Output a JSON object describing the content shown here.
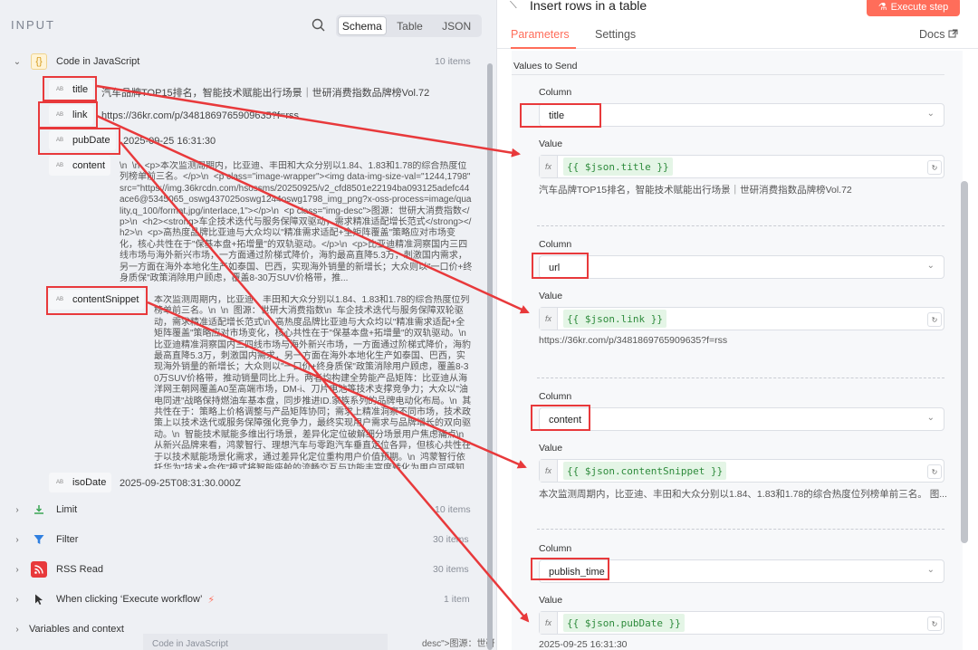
{
  "input_panel": {
    "title": "INPUT",
    "view_tabs": [
      "Schema",
      "Table",
      "JSON"
    ],
    "active_view": "Schema"
  },
  "tree": {
    "code_node": {
      "label": "Code in JavaScript",
      "count": "10 items",
      "icon": "braces-icon"
    },
    "fields": [
      {
        "name": "title",
        "value": "汽车品牌TOP15排名，智能技术赋能出行场景｜世研消费指数品牌榜Vol.72"
      },
      {
        "name": "link",
        "value": "https://36kr.com/p/3481869765909635?f=rss"
      },
      {
        "name": "pubDate",
        "value": "2025-09-25 16:31:30"
      },
      {
        "name": "content",
        "value": "\\n  \\n  <p>本次监测周期内，比亚迪、丰田和大众分别以1.84、1.83和1.78的综合热度位列榜单前三名。</p>\\n  <p class=\"image-wrapper\"><img data-img-size-val=\"1244,1798\" src=\"https://img.36krcdn.com/hsossms/20250925/v2_cfd8501e22194ba093125adefc44ace6@5345065_oswg437025oswg1244oswg1798_img_png?x-oss-process=image/quality,q_100/format,jpg/interlace,1\"></p>\\n  <p class=\"img-desc\">图源：世研大消费指数</p>\\n  <h2><strong>车企技术迭代与服务保障双驱动，需求精准适配增长范式</strong></h2>\\n  <p>高热度品牌比亚迪与大众均以\"精准需求适配+全矩阵覆盖\"策略应对市场变化，核心共性在于\"保基本盘+拓增量\"的双轨驱动。</p>\\n  <p>比亚迪精准洞察国内三四线市场与海外新兴市场，一方面通过阶梯式降价，海豹最高直降5.3万，刺激国内需求，另一方面在海外本地化生产如泰国、巴西，实现海外销量的新增长；大众则以\"一口价+终身质保\"政策消除用户顾虑，覆盖8-30万SUV价格带，推..."
      },
      {
        "name": "contentSnippet",
        "value": "本次监测周期内，比亚迪、丰田和大众分别以1.84、1.83和1.78的综合热度位列榜单前三名。\\n  \\n  图源：世研大消费指数\\n  车企技术迭代与服务保障双轮驱动，需求精准适配增长范式\\n  高热度品牌比亚迪与大众均以\"精准需求适配+全矩阵覆盖\"策略应对市场变化，核心共性在于\"保基本盘+拓增量\"的双轨驱动。\\n  比亚迪精准洞察国内三四线市场与海外新兴市场，一方面通过阶梯式降价，海豹最高直降5.3万，刺激国内需求，另一方面在海外本地化生产如泰国、巴西，实现海外销量的新增长；大众则以\"一口价+终身质保\"政策消除用户顾虑，覆盖8-30万SUV价格带，推动销量同比上升。两者均构建全势能产品矩阵：比亚迪从海洋网王朝网覆盖A0至高端市场，DM-i、刀片电池等技术支撑竞争力；大众以\"油电同进\"战略保持燃油车基本盘，同步推进ID.家族系列的品牌电动化布局。\\n  其共性在于：策略上价格调整与产品矩阵协同；需求上精准洞察不同市场，技术政策上以技术迭代或服务保障强化竞争力，最终实现用户需求与品牌增长的双向驱动。\\n  智能技术赋能多维出行场景，差异化定位破解细分场景用户焦虑痛点\\n  从新兴品牌来看，鸿蒙智行、理想汽车与零跑汽车垂直定位各异，但核心共性在于以技术赋能场景化需求，通过差异化定位重构用户价值预期。\\n  鸿蒙智行依托华为\"技术+合作\"模式将智能座舱的流畅交互与功能丰富度转化为用户可感知的科技体验，直击智能..."
      },
      {
        "name": "isoDate",
        "value": "2025-09-25T08:31:30.000Z"
      }
    ],
    "other_nodes": [
      {
        "label": "Limit",
        "count": "10 items",
        "icon": "limit-icon"
      },
      {
        "label": "Filter",
        "count": "30 items",
        "icon": "filter-icon"
      },
      {
        "label": "RSS Read",
        "count": "30 items",
        "icon": "rss-icon"
      },
      {
        "label": "When clicking ‘Execute workflow’",
        "count": "1 item",
        "icon": "cursor-icon"
      }
    ],
    "variables_label": "Variables and context",
    "bottom_stray": "Code in JavaScript",
    "bottom_stray_right": "desc\">图源：世研"
  },
  "node": {
    "title": "Insert rows in a table",
    "execute_label": "Execute step",
    "tabs": [
      "Parameters",
      "Settings"
    ],
    "active_tab": "Parameters",
    "docs_label": "Docs"
  },
  "form": {
    "section_label": "Values to Send",
    "column_label": "Column",
    "value_label": "Value",
    "fx_label": "fx",
    "rows": [
      {
        "column": "title",
        "expression": "{{ $json.title }}",
        "preview": "汽车品牌TOP15排名，智能技术赋能出行场景｜世研消费指数品牌榜Vol.72"
      },
      {
        "column": "url",
        "expression": "{{ $json.link }}",
        "preview": "https://36kr.com/p/3481869765909635?f=rss"
      },
      {
        "column": "content",
        "expression": "{{ $json.contentSnippet }}",
        "preview": "本次监测周期内，比亚迪、丰田和大众分别以1.84、1.83和1.78的综合热度位列榜单前三名。 图..."
      },
      {
        "column": "publish_time",
        "expression": "{{ $json.pubDate }}",
        "preview": "2025-09-25 16:31:30"
      }
    ]
  },
  "colors": {
    "accent": "#ff6d5a",
    "annotation": "#e8393b",
    "expression_bg": "#e4f5e6",
    "expression_text": "#2e8b3c"
  }
}
